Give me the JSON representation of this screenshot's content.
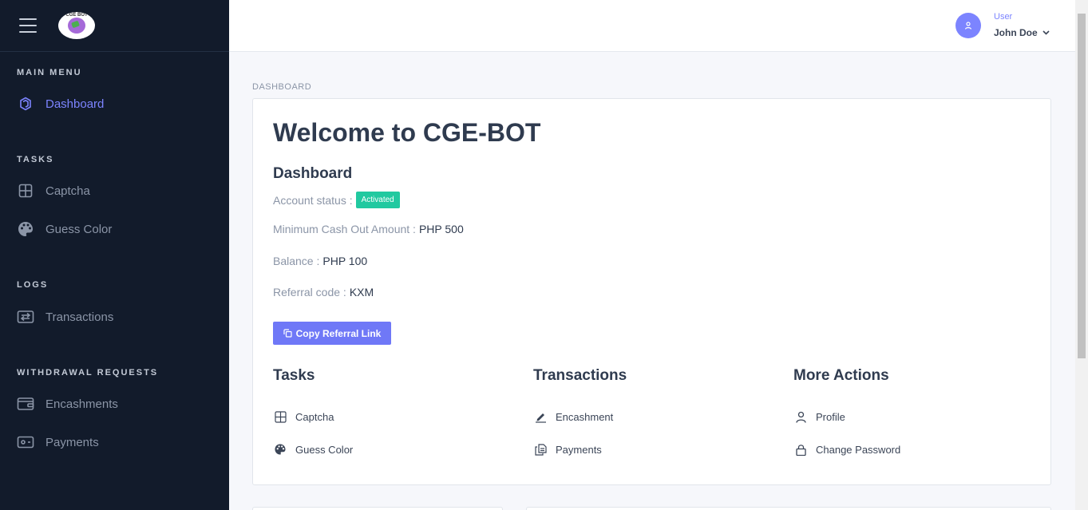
{
  "logo": {
    "text": "CGE BOT"
  },
  "sidebar": {
    "sections": [
      {
        "title": "MAIN MENU",
        "items": [
          {
            "label": "Dashboard",
            "icon": "dashboard-icon"
          }
        ]
      },
      {
        "title": "TASKS",
        "items": [
          {
            "label": "Captcha",
            "icon": "grid-icon"
          },
          {
            "label": "Guess Color",
            "icon": "palette-icon"
          }
        ]
      },
      {
        "title": "LOGS",
        "items": [
          {
            "label": "Transactions",
            "icon": "exchange-icon"
          }
        ]
      },
      {
        "title": "WITHDRAWAL REQUESTS",
        "items": [
          {
            "label": "Encashments",
            "icon": "wallet-icon"
          },
          {
            "label": "Payments",
            "icon": "cash-icon"
          }
        ]
      }
    ]
  },
  "header": {
    "user_role": "User",
    "user_name": "John Doe"
  },
  "main": {
    "breadcrumb": "DASHBOARD",
    "welcome": "Welcome to CGE-BOT",
    "dashboard_title": "Dashboard",
    "account_status_label": "Account status :",
    "account_status_badge": "Activated",
    "min_cashout_label": "Minimum Cash Out Amount :",
    "min_cashout_value": "PHP 500",
    "balance_label": "Balance :",
    "balance_value": "PHP 100",
    "referral_label": "Referral code :",
    "referral_value": "KXM",
    "copy_button": "Copy Referral Link",
    "columns": [
      {
        "title": "Tasks",
        "items": [
          {
            "label": "Captcha",
            "icon": "grid-icon"
          },
          {
            "label": "Guess Color",
            "icon": "palette-icon"
          }
        ]
      },
      {
        "title": "Transactions",
        "items": [
          {
            "label": "Encashment",
            "icon": "edit-icon"
          },
          {
            "label": "Payments",
            "icon": "documents-icon"
          }
        ]
      },
      {
        "title": "More Actions",
        "items": [
          {
            "label": "Profile",
            "icon": "user-icon"
          },
          {
            "label": "Change Password",
            "icon": "lock-icon"
          }
        ]
      }
    ]
  },
  "colors": {
    "sidebar_bg": "#121b2b",
    "accent": "#7c84ff",
    "badge_green": "#21c9a0",
    "button": "#6f78f7"
  }
}
